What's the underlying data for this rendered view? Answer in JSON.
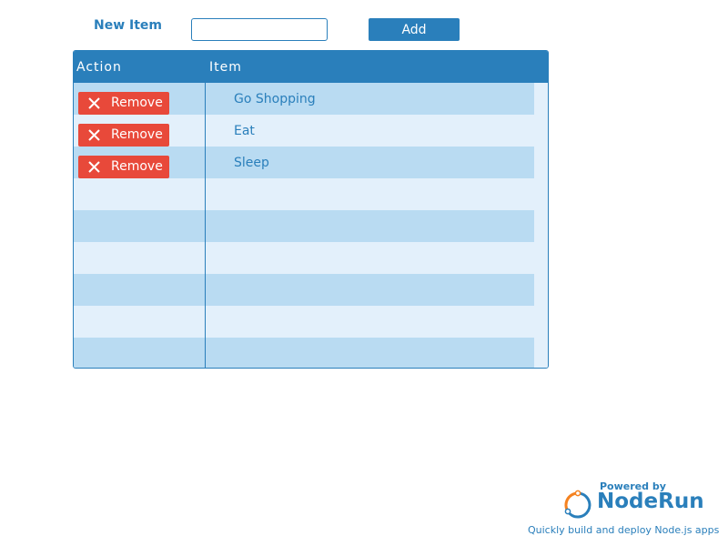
{
  "form": {
    "label": "New Item",
    "input_value": "",
    "input_placeholder": "",
    "add_label": "Add"
  },
  "grid": {
    "headers": {
      "action": "Action",
      "item": "Item"
    },
    "rows": [
      {
        "action_label": "Remove",
        "item": "Go Shopping"
      },
      {
        "action_label": "Remove",
        "item": "Eat"
      },
      {
        "action_label": "Remove",
        "item": "Sleep"
      },
      {
        "action_label": "",
        "item": ""
      },
      {
        "action_label": "",
        "item": ""
      },
      {
        "action_label": "",
        "item": ""
      },
      {
        "action_label": "",
        "item": ""
      },
      {
        "action_label": "",
        "item": ""
      },
      {
        "action_label": "",
        "item": ""
      }
    ]
  },
  "footer": {
    "powered_by": "Powered by",
    "brand": "NodeRun",
    "tagline": "Quickly build and deploy Node.js apps"
  },
  "icons": {
    "remove": "close-icon",
    "logo": "noderun-logo-icon"
  },
  "colors": {
    "primary": "#2a7fbb",
    "row_odd": "#b9dbf2",
    "row_even": "#e3f0fb",
    "danger": "#e8493a",
    "logo_accent": "#f58220"
  }
}
